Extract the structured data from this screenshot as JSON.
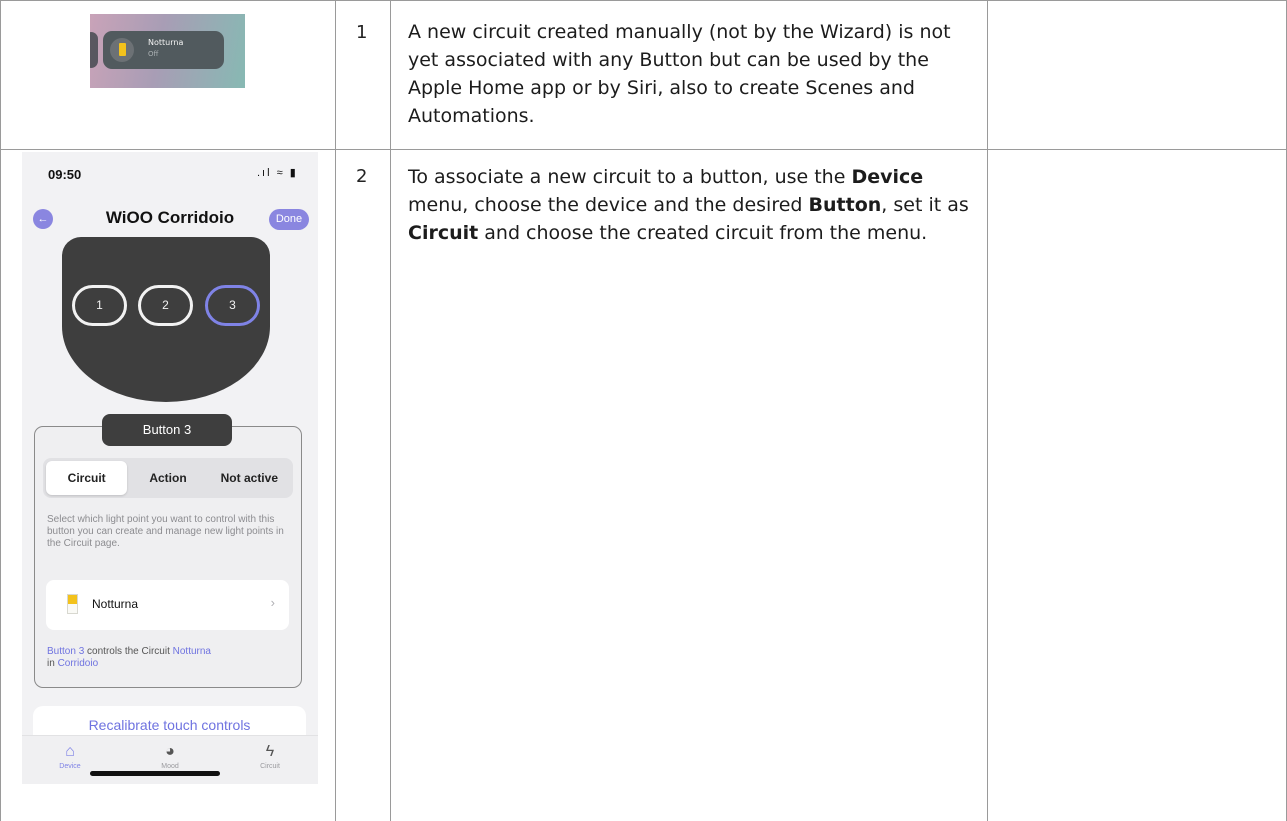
{
  "rows": [
    {
      "number": "1",
      "text": "A new circuit created manually (not by the Wizard) is not yet associated with any Button but can be used by the Apple Home app or by Siri, also to create Scenes and Automations.",
      "thumbnail": {
        "title": "Notturna",
        "state": "Off",
        "accent_color": "#f3c21c"
      }
    },
    {
      "number": "2",
      "text_parts": {
        "p1": "To associate a new circuit to a button, use the ",
        "b1": "Device",
        "p2": " menu, choose the device and the desired ",
        "b2": "Button",
        "p3": ", set it as ",
        "b3": "Circuit",
        "p4": " and choose the created circuit from the menu."
      }
    }
  ],
  "phone": {
    "status": {
      "time": "09:50",
      "icons": ".ıl ≈ ▮"
    },
    "nav": {
      "back_icon": "←",
      "title": "WiOO Corridoio",
      "done_label": "Done"
    },
    "device_buttons": [
      "1",
      "2",
      "3"
    ],
    "selected_button": "3",
    "card": {
      "label": "Button 3",
      "segments": [
        "Circuit",
        "Action",
        "Not active"
      ],
      "active_segment": "Circuit",
      "description": "Select which light point you want to control with this button you can create and manage new light points in the Circuit page.",
      "circuit_name": "Notturna",
      "chevron": "›",
      "link": {
        "a": "Button 3",
        "b": " controls the Circuit ",
        "c": "Notturna",
        "d": "in ",
        "e": "Corridoio"
      }
    },
    "recalibrate_label": "Recalibrate touch controls",
    "tabs": [
      {
        "label": "Device",
        "icon": "home-icon",
        "glyph": "⌂"
      },
      {
        "label": "Mood",
        "icon": "palette-icon",
        "glyph": "◕"
      },
      {
        "label": "Circuit",
        "icon": "bolt-icon",
        "glyph": "ϟ"
      }
    ],
    "accent_color": "#7f83e6"
  }
}
